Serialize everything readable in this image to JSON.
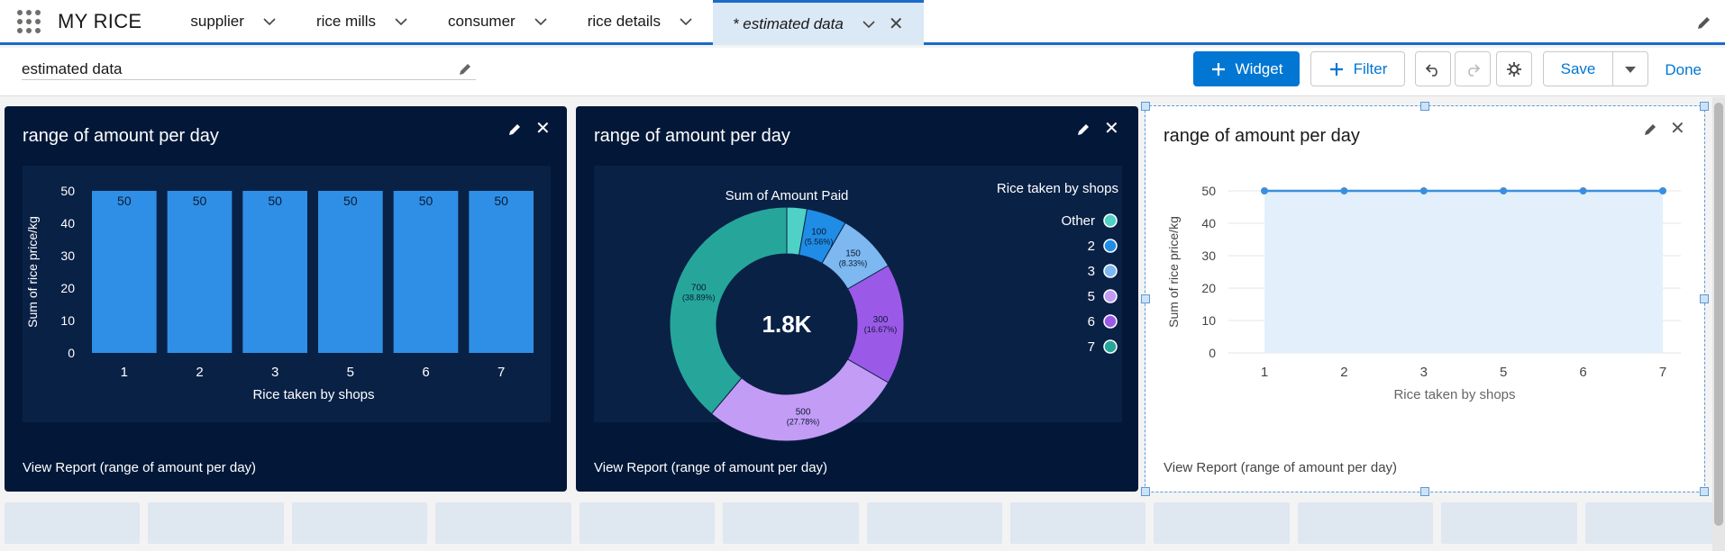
{
  "app": {
    "name": "MY RICE"
  },
  "tabs": [
    {
      "label": "supplier"
    },
    {
      "label": "rice mills"
    },
    {
      "label": "consumer"
    },
    {
      "label": "rice details"
    },
    {
      "label": "* estimated data",
      "active": true
    }
  ],
  "toolbar": {
    "title_value": "estimated data",
    "widget_label": "Widget",
    "filter_label": "Filter",
    "save_label": "Save",
    "done_label": "Done"
  },
  "widgets": [
    {
      "title": "range of amount per day",
      "footer": "View Report (range of amount per day)"
    },
    {
      "title": "range of amount per day",
      "footer": "View Report (range of amount per day)"
    },
    {
      "title": "range of amount per day",
      "footer": "View Report (range of amount per day)"
    }
  ],
  "colors": {
    "brand": "#0176d3",
    "dark_bg": "#031838",
    "bar": "#2f8fe6"
  },
  "chart_data": [
    {
      "type": "bar",
      "categories": [
        "1",
        "2",
        "3",
        "5",
        "6",
        "7"
      ],
      "values": [
        50,
        50,
        50,
        50,
        50,
        50
      ],
      "data_labels": [
        "50",
        "50",
        "50",
        "50",
        "50",
        "50"
      ],
      "xlabel": "Rice taken by shops",
      "ylabel": "Sum of rice price/kg",
      "yticks": [
        "0",
        "10",
        "20",
        "30",
        "40",
        "50"
      ],
      "ylim": [
        0,
        50
      ]
    },
    {
      "type": "pie",
      "subtitle": "Sum of Amount Paid",
      "center_label": "1.8K",
      "legend_title": "Rice taken by shops",
      "slices": [
        {
          "label": "Other",
          "value": 50,
          "color": "#4fd1c5"
        },
        {
          "label": "2",
          "value": 100,
          "pct": "5.56%",
          "color": "#1f8de6"
        },
        {
          "label": "3",
          "value": 150,
          "pct": "8.33%",
          "color": "#7db8f0"
        },
        {
          "label": "6",
          "value": 300,
          "pct": "16.67%",
          "color": "#9b59e8"
        },
        {
          "label": "5",
          "value": 500,
          "pct": "27.78%",
          "color": "#c39cf5"
        },
        {
          "label": "7",
          "value": 700,
          "pct": "38.89%",
          "color": "#26a69a"
        }
      ],
      "legend": [
        {
          "label": "Other",
          "color": "#4fd1c5"
        },
        {
          "label": "2",
          "color": "#1f8de6"
        },
        {
          "label": "3",
          "color": "#7db8f0"
        },
        {
          "label": "5",
          "color": "#c39cf5"
        },
        {
          "label": "6",
          "color": "#9b59e8"
        },
        {
          "label": "7",
          "color": "#26a69a"
        }
      ]
    },
    {
      "type": "area",
      "categories": [
        "1",
        "2",
        "3",
        "5",
        "6",
        "7"
      ],
      "values": [
        50,
        50,
        50,
        50,
        50,
        50
      ],
      "xlabel": "Rice taken by shops",
      "ylabel": "Sum of rice price/kg",
      "yticks": [
        "0",
        "10",
        "20",
        "30",
        "40",
        "50"
      ],
      "ylim": [
        0,
        50
      ]
    }
  ]
}
